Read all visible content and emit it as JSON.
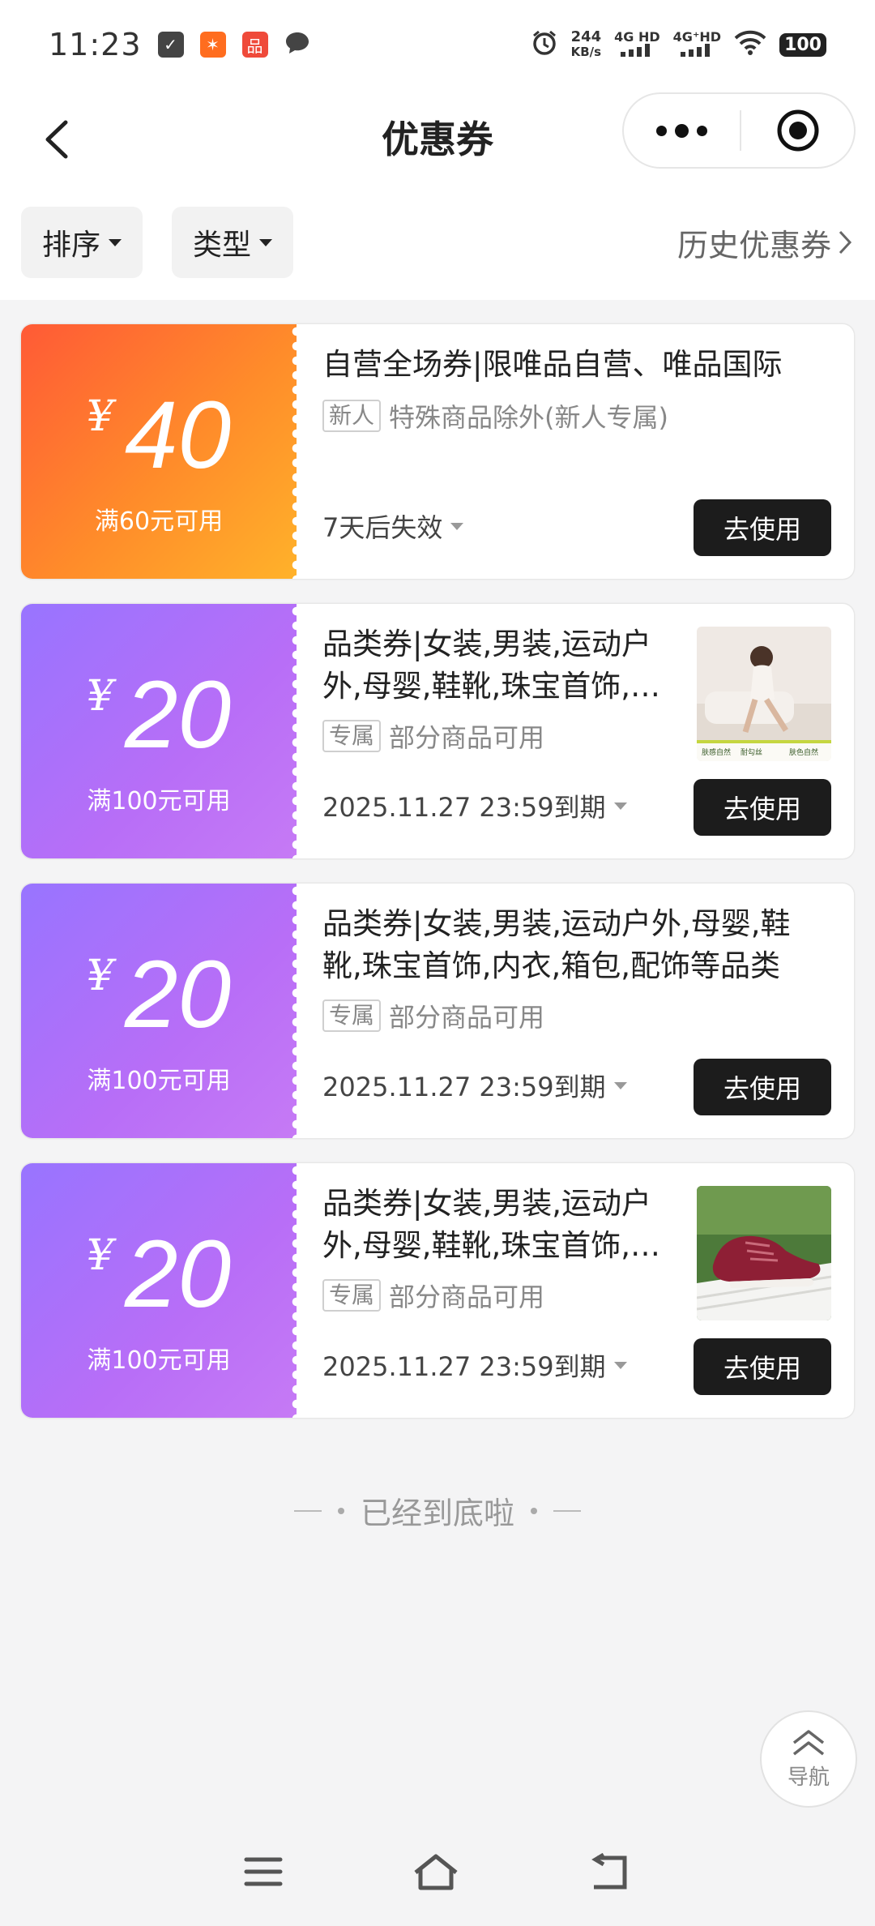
{
  "status_bar": {
    "time": "11:23",
    "speed_value": "244",
    "speed_unit": "KB/s",
    "net1": "4G HD",
    "net2": "4G⁺HD",
    "battery": "100"
  },
  "nav": {
    "title": "优惠券"
  },
  "filters": {
    "sort_label": "排序",
    "type_label": "类型",
    "history_label": "历史优惠券"
  },
  "coupons": [
    {
      "currency": "¥",
      "amount": "40",
      "condition": "满60元可用",
      "title": "自营全场券|限唯品自营、唯品国际",
      "tag": "新人",
      "scope": "特殊商品除外(新人专属)",
      "expiry": "7天后失效",
      "button": "去使用",
      "color": "#ff6a30"
    },
    {
      "currency": "¥",
      "amount": "20",
      "condition": "满100元可用",
      "title": "品类券|女装,男装,运动户外,母婴,鞋靴,珠宝首饰,内衣,箱包,配饰等品类",
      "tag": "专属",
      "scope": "部分商品可用",
      "expiry": "2025.11.27 23:59到期",
      "button": "去使用",
      "color": "#a874fb"
    },
    {
      "currency": "¥",
      "amount": "20",
      "condition": "满100元可用",
      "title": "品类券|女装,男装,运动户外,母婴,鞋靴,珠宝首饰,内衣,箱包,配饰等品类",
      "tag": "专属",
      "scope": "部分商品可用",
      "expiry": "2025.11.27 23:59到期",
      "button": "去使用",
      "color": "#a874fb"
    },
    {
      "currency": "¥",
      "amount": "20",
      "condition": "满100元可用",
      "title": "品类券|女装,男装,运动户外,母婴,鞋靴,珠宝首饰,内衣,箱包,配饰等品类",
      "tag": "专属",
      "scope": "部分商品可用",
      "expiry": "2025.11.27 23:59到期",
      "button": "去使用",
      "color": "#a874fb"
    }
  ],
  "product_thumb_1": {
    "text_a": "肤感自然",
    "text_b": "耐勾丝",
    "text_c": "肤色自然"
  },
  "footer": {
    "end_text": "已经到底啦",
    "fab_label": "导航"
  }
}
